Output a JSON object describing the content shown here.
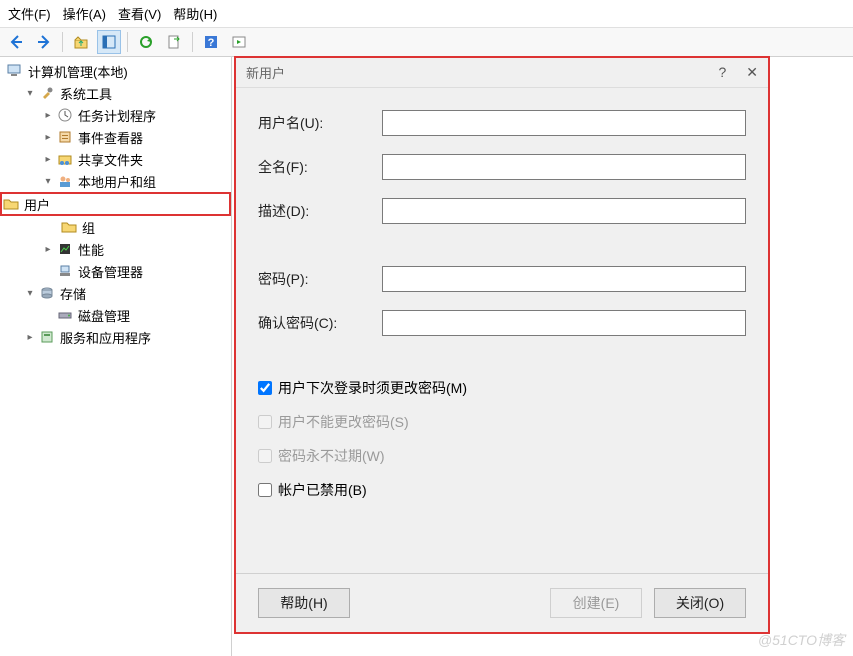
{
  "menu": {
    "file": "文件(F)",
    "action": "操作(A)",
    "view": "查看(V)",
    "help": "帮助(H)"
  },
  "toolbar": {
    "back": "back-icon",
    "forward": "forward-icon",
    "up": "up-folder-icon",
    "props": "properties-icon",
    "refresh": "refresh-icon",
    "export": "export-icon",
    "help": "help-icon",
    "run": "run-icon"
  },
  "tree": {
    "root": "计算机管理(本地)",
    "sys_tools": "系统工具",
    "task_scheduler": "任务计划程序",
    "event_viewer": "事件查看器",
    "shared_folders": "共享文件夹",
    "local_users_groups": "本地用户和组",
    "users": "用户",
    "groups": "组",
    "performance": "性能",
    "device_manager": "设备管理器",
    "storage": "存储",
    "disk_mgmt": "磁盘管理",
    "services_apps": "服务和应用程序"
  },
  "dialog": {
    "title": "新用户",
    "username_label": "用户名(U):",
    "fullname_label": "全名(F):",
    "desc_label": "描述(D):",
    "password_label": "密码(P):",
    "confirm_label": "确认密码(C):",
    "chk_must_change": "用户下次登录时须更改密码(M)",
    "chk_cannot_change": "用户不能更改密码(S)",
    "chk_never_expires": "密码永不过期(W)",
    "chk_disabled": "帐户已禁用(B)",
    "btn_help": "帮助(H)",
    "btn_create": "创建(E)",
    "btn_close": "关闭(O)",
    "values": {
      "username": "",
      "fullname": "",
      "desc": "",
      "password": "",
      "confirm": "",
      "must_change": true,
      "cannot_change": false,
      "never_expires": false,
      "acct_disabled": false
    }
  },
  "watermark": "@51CTO博客"
}
